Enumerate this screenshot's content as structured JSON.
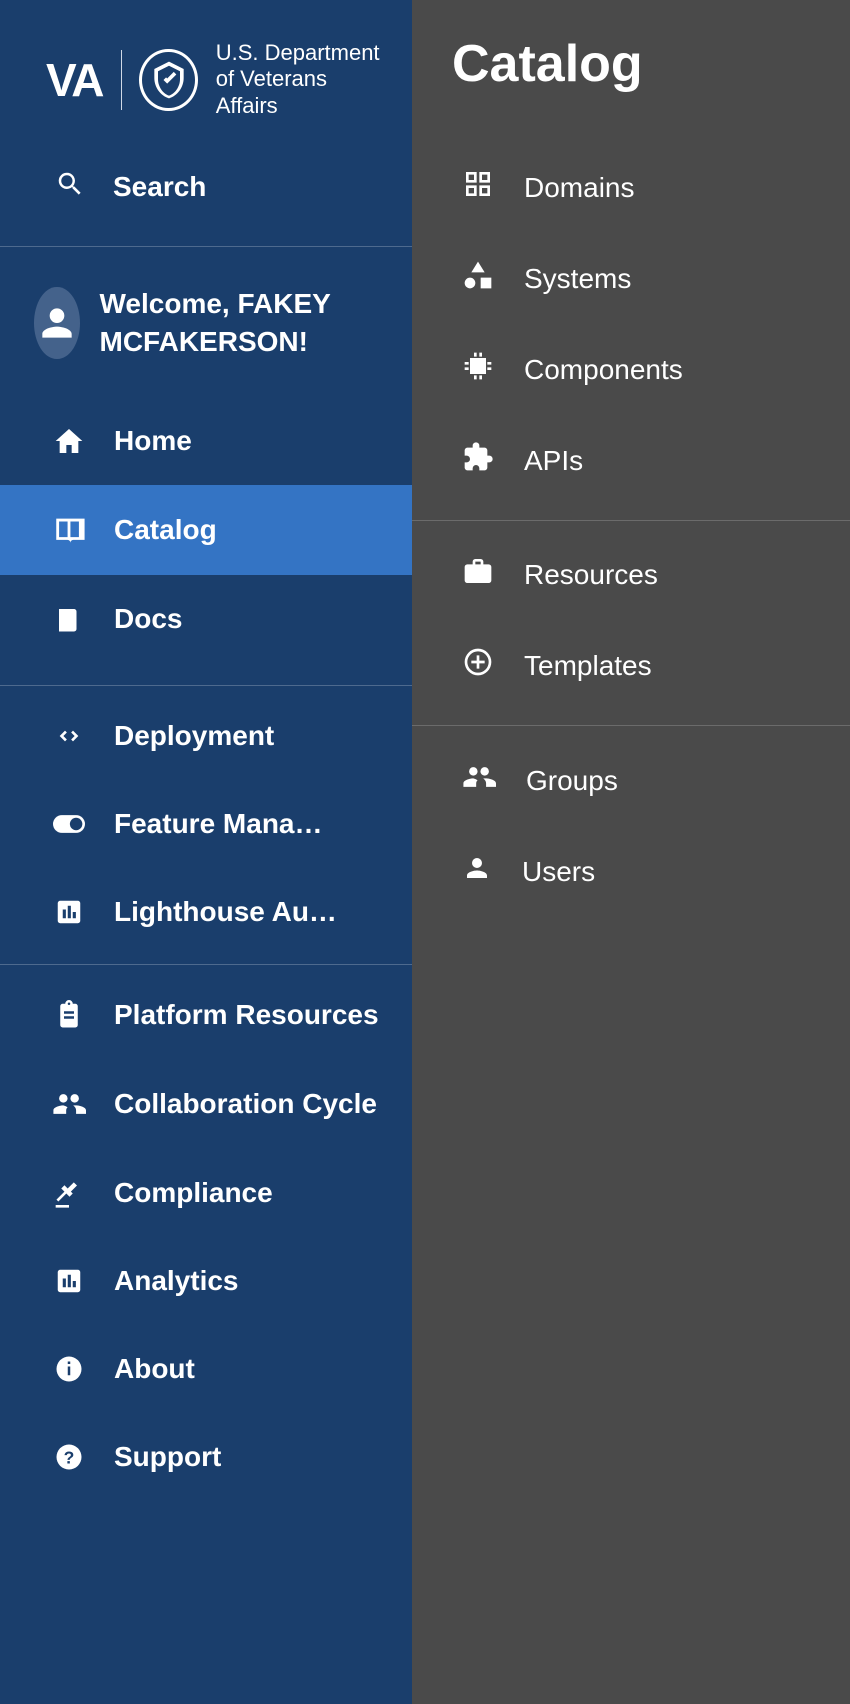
{
  "logo": {
    "va": "VA",
    "line1": "U.S. Department",
    "line2": "of Veterans Affairs"
  },
  "search_label": "Search",
  "welcome": "Welcome, FAKEY MCFAKERSON!",
  "nav": {
    "group1": [
      {
        "label": "Home"
      },
      {
        "label": "Catalog"
      },
      {
        "label": "Docs"
      }
    ],
    "group2": [
      {
        "label": "Deployment"
      },
      {
        "label": "Feature Mana…"
      },
      {
        "label": "Lighthouse Au…"
      }
    ],
    "group3": [
      {
        "label": "Platform Resources"
      },
      {
        "label": "Collaboration Cycle"
      },
      {
        "label": "Compliance"
      },
      {
        "label": "Analytics"
      },
      {
        "label": "About"
      },
      {
        "label": "Support"
      }
    ]
  },
  "subpanel": {
    "title": "Catalog",
    "group1": [
      {
        "label": "Domains"
      },
      {
        "label": "Systems"
      },
      {
        "label": "Components"
      },
      {
        "label": "APIs"
      }
    ],
    "group2": [
      {
        "label": "Resources"
      },
      {
        "label": "Templates"
      }
    ],
    "group3": [
      {
        "label": "Groups"
      },
      {
        "label": "Users"
      }
    ]
  }
}
